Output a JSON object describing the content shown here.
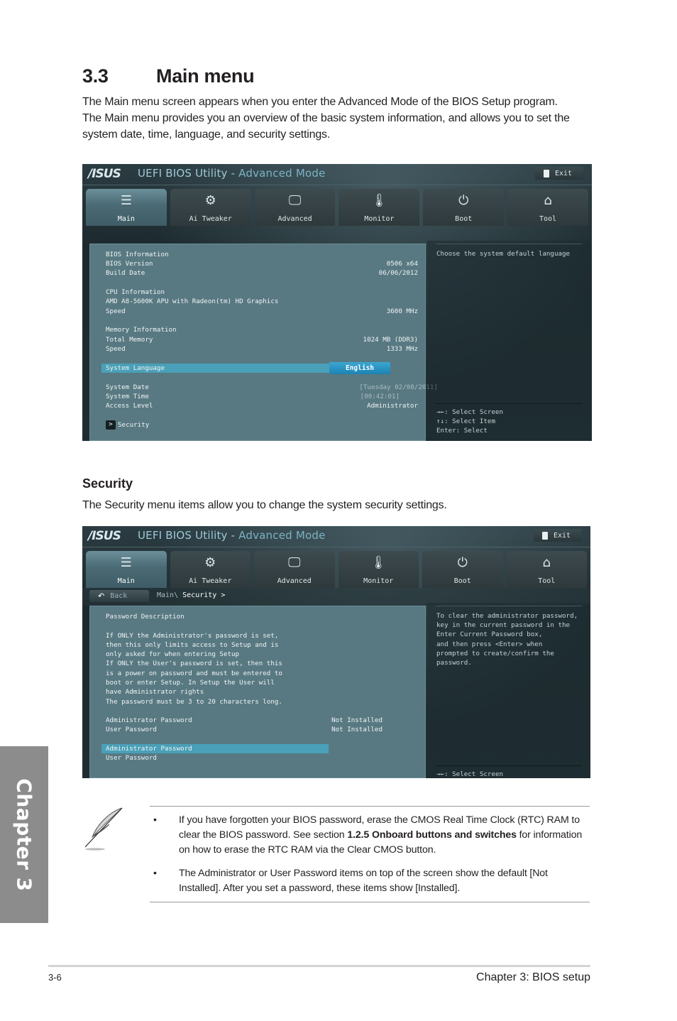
{
  "section": {
    "number": "3.3",
    "title": "Main menu",
    "intro": "The Main menu screen appears when you enter the Advanced Mode of the BIOS Setup program. The Main menu provides you an overview of the basic system information, and allows you to set the system date, time, language, and security settings."
  },
  "bios_common": {
    "logo": "/ISUS",
    "app_title": "UEFI BIOS Utility - ",
    "mode": "Advanced Mode",
    "exit_label": "Exit",
    "tabs": [
      {
        "label": "Main",
        "icon": "list-icon",
        "glyph": "☰",
        "active": true
      },
      {
        "label": "Ai Tweaker",
        "icon": "tweaker-icon",
        "glyph": "⚙",
        "active": false
      },
      {
        "label": "Advanced",
        "icon": "advanced-icon",
        "glyph": "🖵",
        "active": false
      },
      {
        "label": "Monitor",
        "icon": "monitor-icon",
        "glyph": "🌡",
        "active": false
      },
      {
        "label": "Boot",
        "icon": "power-icon",
        "glyph": "⏻",
        "active": false
      },
      {
        "label": "Tool",
        "icon": "toolbox-icon",
        "glyph": "⌂",
        "active": false
      }
    ]
  },
  "main_screen": {
    "bios_info_header": "BIOS Information",
    "bios_version_label": "BIOS Version",
    "bios_version_value": "0506 x64",
    "build_date_label": "Build Date",
    "build_date_value": "06/06/2012",
    "cpu_info_header": "CPU Information",
    "cpu_name": "AMD A8-5600K APU with Radeon(tm) HD Graphics",
    "cpu_speed_label": "Speed",
    "cpu_speed_value": "3600 MHz",
    "mem_info_header": "Memory Information",
    "total_memory_label": "Total Memory",
    "total_memory_value": "1024 MB (DDR3)",
    "mem_speed_label": "Speed",
    "mem_speed_value": "1333 MHz",
    "system_language_label": "System Language",
    "system_language_value": "English",
    "system_date_label": "System Date",
    "system_date_value": "[Tuesday 02/08/2011]",
    "system_time_label": "System Time",
    "system_time_value": "[00:42:01]",
    "access_level_label": "Access Level",
    "access_level_value": "Administrator",
    "security_link": "Security",
    "help_text": "Choose the system default language",
    "hints": [
      "→←: Select Screen",
      "↑↓: Select Item",
      "Enter: Select"
    ]
  },
  "security_heading": {
    "title": "Security",
    "desc": "The Security menu items allow you to change the system security settings."
  },
  "security_screen": {
    "back_label": "Back",
    "breadcrumb_parent": "Main\\",
    "breadcrumb_current": "Security >",
    "password_description": "Password Description\n\nIf ONLY the Administrator's password is set,\nthen this only limits access to Setup and is\nonly asked for when entering Setup\nIf ONLY the User's password is set, then this\nis a power on password and must be entered to\nboot or enter Setup. In Setup the User will\nhave Administrator rights\nThe password must be 3 to 20 characters long.",
    "admin_pw_status_label": "Administrator Password",
    "admin_pw_status_value": "Not Installed",
    "user_pw_status_label": "User Password",
    "user_pw_status_value": "Not Installed",
    "admin_pw_item": "Administrator Password",
    "user_pw_item": "User Password",
    "help_text": "To clear the administrator password,\nkey in the current password in the\nEnter Current Password box,\nand then press <Enter> when\nprompted to create/confirm the\npassword.",
    "hint": "→←: Select Screen"
  },
  "note": {
    "items": [
      {
        "pre": "If you have forgotten your BIOS password, erase the CMOS Real Time Clock (RTC) RAM to clear the BIOS password. See section ",
        "bold": "1.2.5 Onboard buttons and switches",
        "post": " for information on how to erase the RTC RAM via the Clear CMOS button."
      },
      {
        "pre": "The Administrator or User Password items on top of the screen show the default [Not Installed]. After you set a password, these items show [Installed].",
        "bold": "",
        "post": ""
      }
    ],
    "bullet": "•"
  },
  "side_tab": "Chapter 3",
  "footer": {
    "page_number": "3-6",
    "chapter_title": "Chapter 3: BIOS setup"
  }
}
